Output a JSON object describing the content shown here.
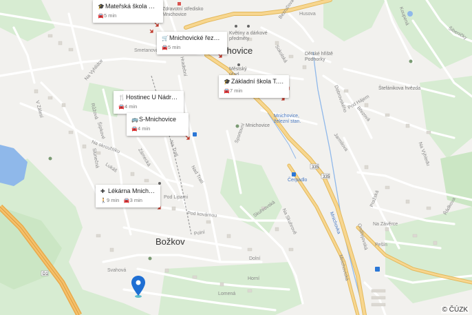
{
  "map": {
    "copyright": "© ČÚZK",
    "places": {
      "mnichovice": "nichovice",
      "bozkov": "Božkov"
    },
    "road_numbers": [
      "335",
      "335"
    ],
    "highway_number": "D1",
    "streets": [
      "Na Vyhlídce",
      "V Zálesí",
      "Šípkové",
      "Růžová",
      "Na okrouhlíku",
      "Slunečná",
      "Lukáš",
      "Zámecká",
      "Na Trati",
      "Nad Trati",
      "Nad Tratí",
      "Pod Lipami",
      "Pod kovárnou",
      "Polní",
      "Svahová",
      "Dolní",
      "Horní",
      "Lomená",
      "Hradební",
      "Smetanova",
      "Husova",
      "Sokolská",
      "Bezručova",
      "Sportovní",
      "Skuhrovská",
      "Na Skuhrově",
      "Nad Skuhrově",
      "Mnichovická",
      "Mnichovka",
      "Jarmilova",
      "Pod Hájem",
      "Březová",
      "Na Závěrce",
      "Pešín",
      "Pod myslivnou",
      "Ondřejovská",
      "Pražská",
      "Na Výhledu",
      "Šibeničky",
      "Koupená",
      "Dobrovského",
      "Pod Ořechovkou",
      "Řádkova",
      "Sladkovského"
    ],
    "pois": {
      "zdravotni_stredisko": "Zdravotní středisko Mnichovice",
      "kvetiny": "Květiny a dárkové předměty",
      "mestsky_urad": "Městský úřad Mnichovice",
      "detske_hriste": "Dětské hřiště Podhorky",
      "stefanikova_hvezda": "Štefánikova hvězda",
      "mnichovice_zeleznice": "Mnichovice, železní stan.",
      "mnichovice_small": "Mnichovice",
      "cerpadlo": "Čerpadlo"
    },
    "cards": [
      {
        "title": "Mateřská škola M...",
        "icon": "school-icon",
        "walk": null,
        "drive": "5 min"
      },
      {
        "title": "Mnichovické řezn...",
        "icon": "cart-icon",
        "walk": null,
        "drive": "5 min"
      },
      {
        "title": "Základní škola T. ...",
        "icon": "school-icon",
        "walk": null,
        "drive": "7 min"
      },
      {
        "title": "Hostinec U Nádraží",
        "icon": "restaurant-icon",
        "walk": null,
        "drive": "4 min"
      },
      {
        "title": "S-Mnichovice",
        "icon": "bus-icon",
        "walk": null,
        "drive": "4 min"
      },
      {
        "title": "Lékárna Mnichovi...",
        "icon": "pharmacy-icon",
        "walk": "9 min",
        "drive": "3 min"
      }
    ]
  },
  "colors": {
    "background": "#f2f1ee",
    "road_main": "#f7d68f",
    "road_main_border": "#e3b85a",
    "road_minor": "#ffffff",
    "green": "#d5ecd0",
    "water": "#8fb8ea",
    "highway": "#f0b45c",
    "pin": "#1f6fd3",
    "card_arrow": "#c0392b"
  }
}
